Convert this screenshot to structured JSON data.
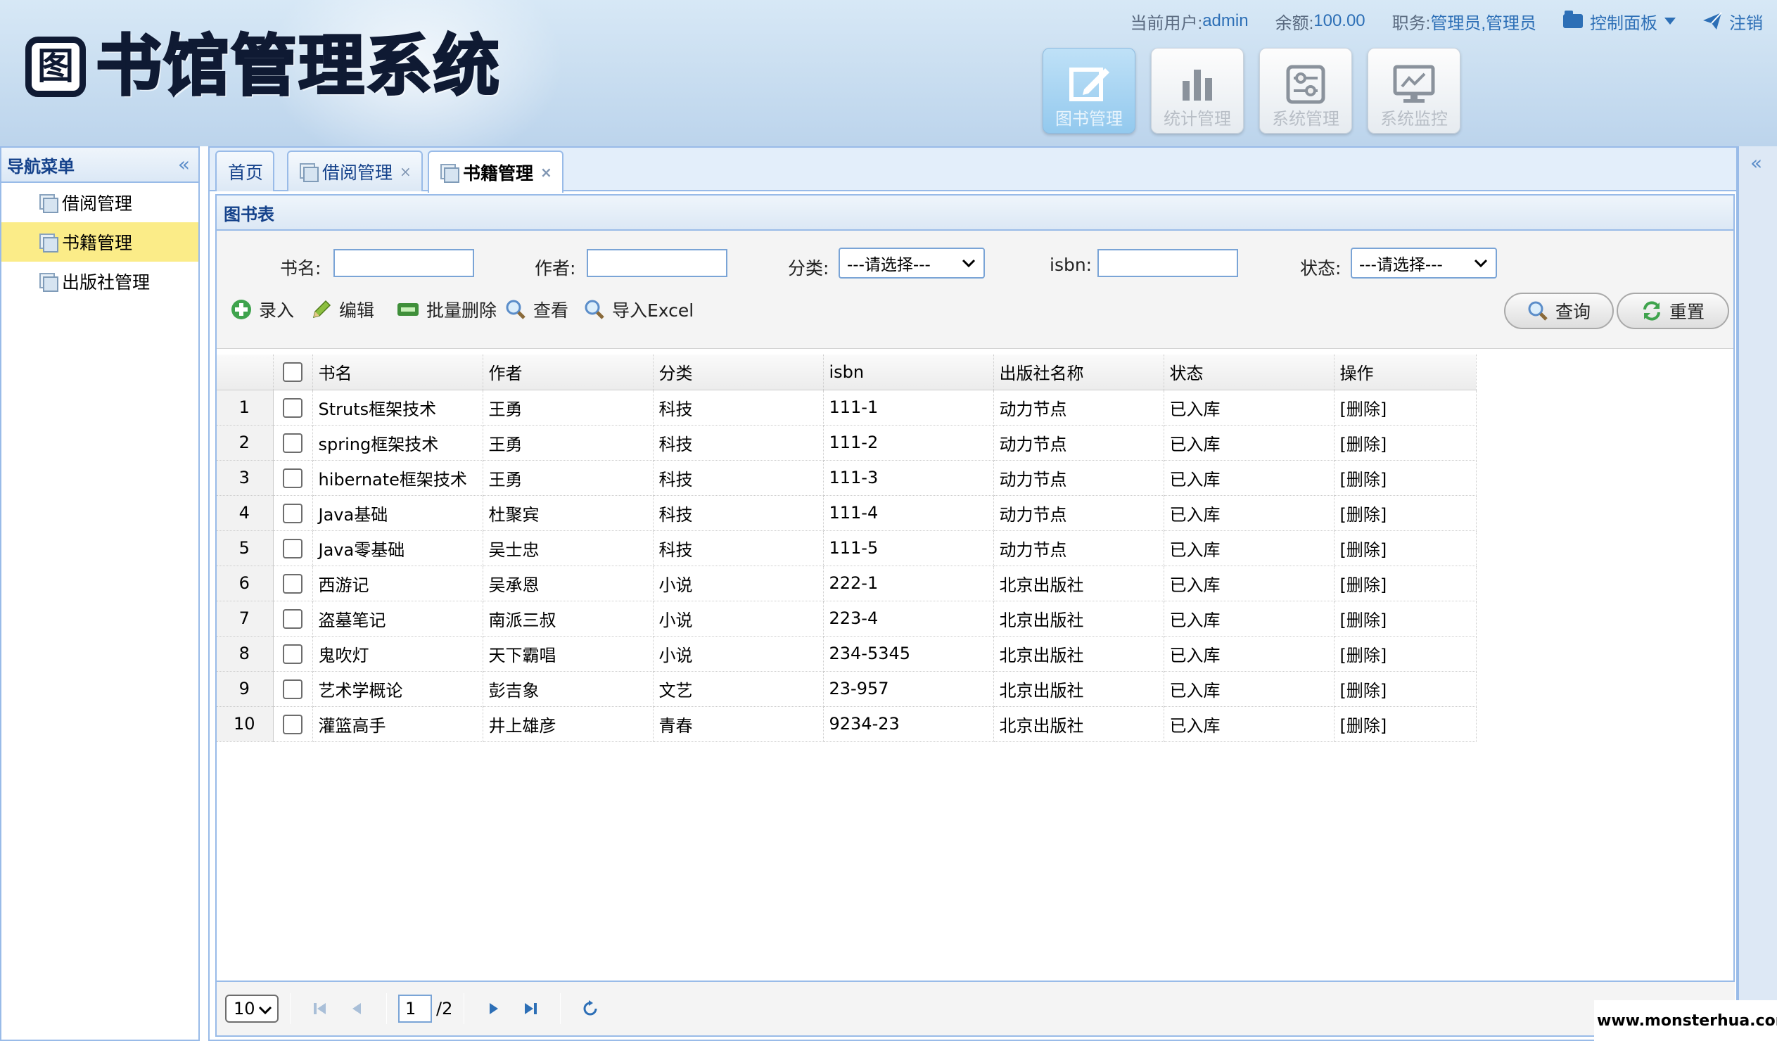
{
  "app": {
    "title": "图书馆管理系统",
    "logo_glyph": "图",
    "title_rest": "书馆管理系统"
  },
  "topbar": {
    "user_label": "当前用户:",
    "user_value": "admin",
    "balance_label": "余额:",
    "balance_value": "100.00",
    "role_label": "职务:",
    "role_value": "管理员,管理员",
    "panel_label": "控制面板",
    "logout_label": "注销"
  },
  "modules": [
    {
      "label": "图书管理",
      "icon": "edit-icon",
      "active": true
    },
    {
      "label": "统计管理",
      "icon": "bar-chart-icon",
      "active": false
    },
    {
      "label": "系统管理",
      "icon": "sliders-icon",
      "active": false
    },
    {
      "label": "系统监控",
      "icon": "monitor-icon",
      "active": false
    }
  ],
  "nav": {
    "title": "导航菜单",
    "collapse_glyph": "«",
    "items": [
      {
        "label": "借阅管理",
        "selected": false
      },
      {
        "label": "书籍管理",
        "selected": true
      },
      {
        "label": "出版社管理",
        "selected": false
      }
    ]
  },
  "tabs": [
    {
      "label": "首页",
      "closable": false
    },
    {
      "label": "借阅管理",
      "closable": true
    },
    {
      "label": "书籍管理",
      "closable": true,
      "selected": true
    }
  ],
  "tab_close_glyph": "×",
  "grid": {
    "title": "图书表",
    "filters": {
      "name_label": "书名:",
      "author_label": "作者:",
      "category_label": "分类:",
      "isbn_label": "isbn:",
      "status_label": "状态:",
      "category_value": "---请选择---",
      "status_value": "---请选择---"
    },
    "actions": {
      "add": "录入",
      "edit": "编辑",
      "batch_delete": "批量删除",
      "view": "查看",
      "import": "导入Excel"
    },
    "search_button": "查询",
    "reset_button": "重置",
    "columns": [
      "书名",
      "作者",
      "分类",
      "isbn",
      "出版社名称",
      "状态",
      "操作"
    ],
    "rows": [
      {
        "num": "1",
        "name": "Struts框架技术",
        "author": "王勇",
        "category": "科技",
        "isbn": "111-1",
        "publisher": "动力节点",
        "status": "已入库",
        "op": "[删除]"
      },
      {
        "num": "2",
        "name": "spring框架技术",
        "author": "王勇",
        "category": "科技",
        "isbn": "111-2",
        "publisher": "动力节点",
        "status": "已入库",
        "op": "[删除]"
      },
      {
        "num": "3",
        "name": "hibernate框架技术",
        "author": "王勇",
        "category": "科技",
        "isbn": "111-3",
        "publisher": "动力节点",
        "status": "已入库",
        "op": "[删除]"
      },
      {
        "num": "4",
        "name": "Java基础",
        "author": "杜聚宾",
        "category": "科技",
        "isbn": "111-4",
        "publisher": "动力节点",
        "status": "已入库",
        "op": "[删除]"
      },
      {
        "num": "5",
        "name": "Java零基础",
        "author": "吴士忠",
        "category": "科技",
        "isbn": "111-5",
        "publisher": "动力节点",
        "status": "已入库",
        "op": "[删除]"
      },
      {
        "num": "6",
        "name": "西游记",
        "author": "吴承恩",
        "category": "小说",
        "isbn": "222-1",
        "publisher": "北京出版社",
        "status": "已入库",
        "op": "[删除]"
      },
      {
        "num": "7",
        "name": "盗墓笔记",
        "author": "南派三叔",
        "category": "小说",
        "isbn": "223-4",
        "publisher": "北京出版社",
        "status": "已入库",
        "op": "[删除]"
      },
      {
        "num": "8",
        "name": "鬼吹灯",
        "author": "天下霸唱",
        "category": "小说",
        "isbn": "234-5345",
        "publisher": "北京出版社",
        "status": "已入库",
        "op": "[删除]"
      },
      {
        "num": "9",
        "name": "艺术学概论",
        "author": "彭吉象",
        "category": "文艺",
        "isbn": "23-957",
        "publisher": "北京出版社",
        "status": "已入库",
        "op": "[删除]"
      },
      {
        "num": "10",
        "name": "灌篮高手",
        "author": "井上雄彦",
        "category": "青春",
        "isbn": "9234-23",
        "publisher": "北京出版社",
        "status": "已入库",
        "op": "[删除]"
      }
    ]
  },
  "pager": {
    "page_size": "10",
    "current_page": "1",
    "total_pages": "/2"
  },
  "watermark": "www.monsterhua.com",
  "colors": {
    "accent": "#15428b",
    "border": "#99bbe8",
    "selected_nav": "#fbec88",
    "link": "#2d6fb6"
  }
}
